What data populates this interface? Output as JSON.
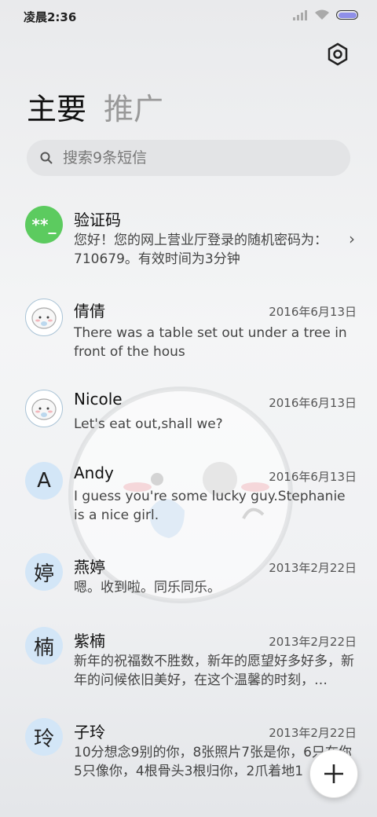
{
  "status_bar": {
    "time": "凌晨2:36"
  },
  "tabs": {
    "primary": "主要",
    "promo": "推广"
  },
  "search": {
    "placeholder": "搜索9条短信"
  },
  "messages": [
    {
      "avatar": "**_",
      "name": "验证码",
      "date": "",
      "preview": "您好！您的网上营业厅登录的随机密码为：710679。有效时间为3分钟"
    },
    {
      "avatar": "",
      "name": "倩倩",
      "date": "2016年6月13日",
      "preview": "There was a table set out under a tree in front of the hous"
    },
    {
      "avatar": "",
      "name": "Nicole",
      "date": "2016年6月13日",
      "preview": "Let's eat out,shall we?"
    },
    {
      "avatar": "A",
      "name": "Andy",
      "date": "2016年6月13日",
      "preview": "I guess you're some lucky guy.Stephanie is a nice girl."
    },
    {
      "avatar": "婷",
      "name": "燕婷",
      "date": "2013年2月22日",
      "preview": "嗯。收到啦。同乐同乐。"
    },
    {
      "avatar": "楠",
      "name": "紫楠",
      "date": "2013年2月22日",
      "preview": "新年的祝福数不胜数，新年的愿望好多好多，新年的问候依旧美好，在这个温馨的时刻，…"
    },
    {
      "avatar": "玲",
      "name": "子玲",
      "date": "2013年2月22日",
      "preview": "10分想念9别的你，8张照片7张是你，6只在你5只像你，4根骨头3根归你，2爪着地1"
    }
  ],
  "colors": {
    "accent_green": "#5ccb5f",
    "avatar_blue": "#d3e6f7",
    "battery": "#8f8fe8"
  }
}
